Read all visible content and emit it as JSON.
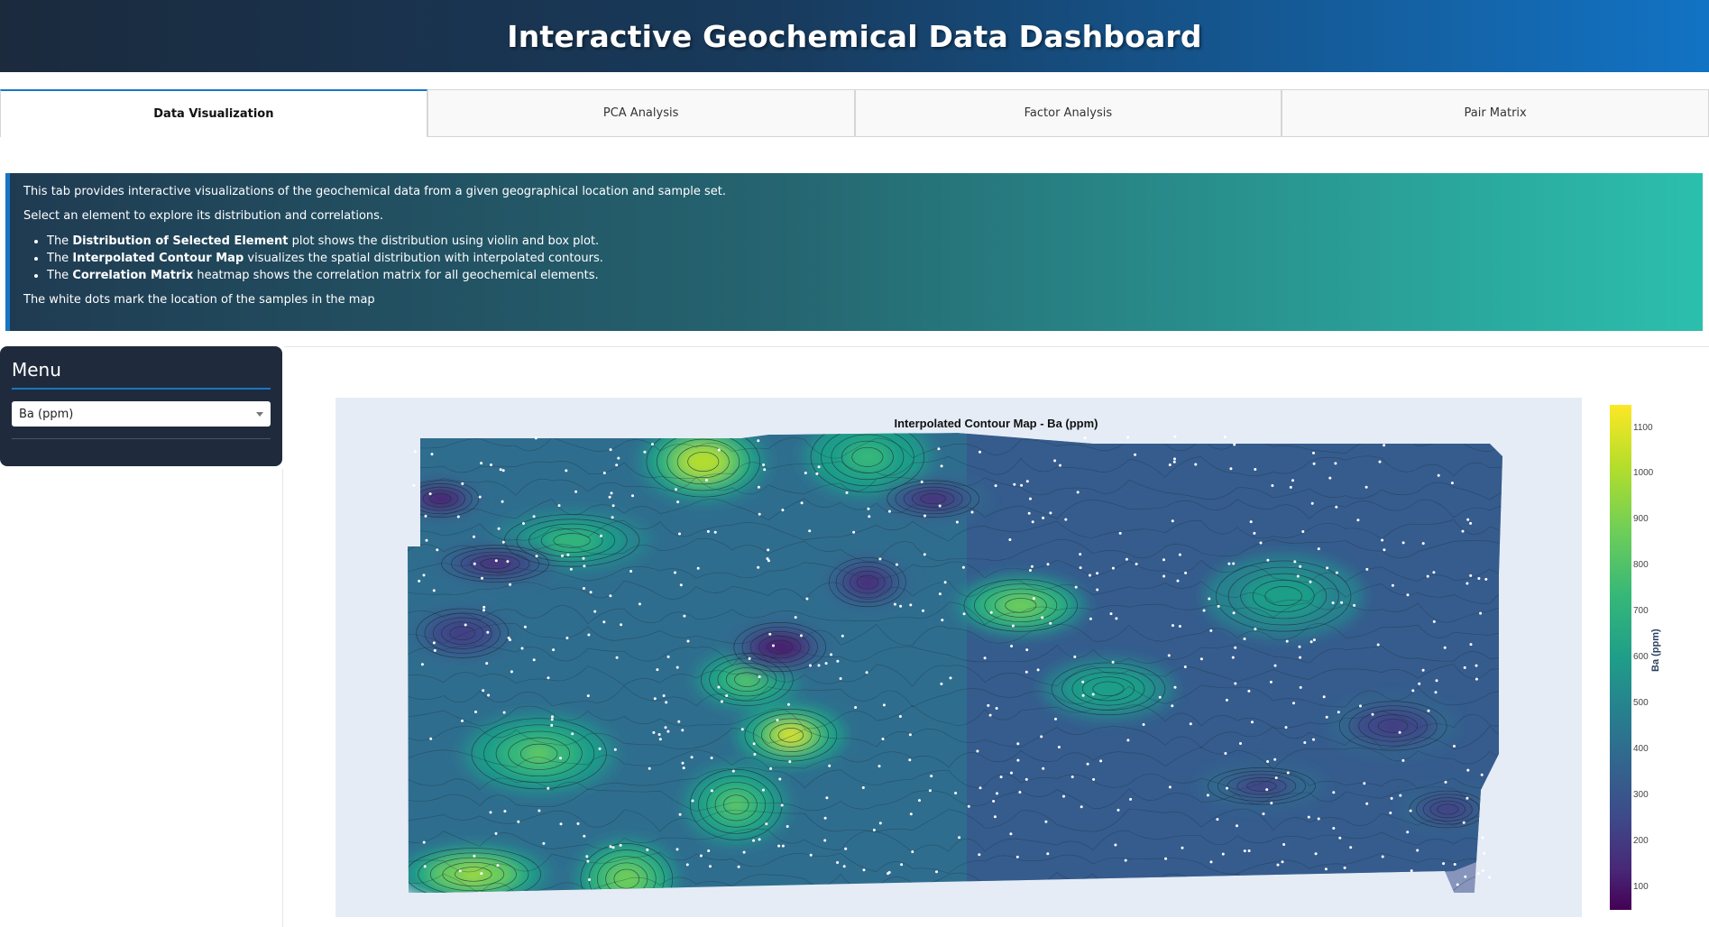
{
  "header": {
    "title": "Interactive Geochemical Data Dashboard"
  },
  "tabs": [
    {
      "label": "Data Visualization",
      "active": true
    },
    {
      "label": "PCA Analysis",
      "active": false
    },
    {
      "label": "Factor Analysis",
      "active": false
    },
    {
      "label": "Pair Matrix",
      "active": false
    }
  ],
  "info": {
    "line1": "This tab provides interactive visualizations of the geochemical data from a given geographical location and sample set.",
    "line2": "Select an element to explore its distribution and correlations.",
    "bullets": [
      {
        "pre": "The ",
        "bold": "Distribution of Selected Element",
        "post": " plot shows the distribution using violin and box plot."
      },
      {
        "pre": "The ",
        "bold": "Interpolated Contour Map",
        "post": " visualizes the spatial distribution with interpolated contours."
      },
      {
        "pre": "The ",
        "bold": "Correlation Matrix",
        "post": " heatmap shows the correlation matrix for all geochemical elements."
      }
    ],
    "line3": "The white dots mark the location of the samples in the map"
  },
  "menu": {
    "title": "Menu",
    "selected_element": "Ba (ppm)"
  },
  "chart_data": {
    "type": "heatmap",
    "title": "Interpolated Contour Map - Ba (ppm)",
    "colorbar_title": "Ba (ppm)",
    "colorbar_range": [
      50,
      1150
    ],
    "colorbar_ticks": [
      100,
      200,
      300,
      400,
      500,
      600,
      700,
      800,
      900,
      1000,
      1100
    ],
    "colorscale": "viridis",
    "hotspots": [
      {
        "x": 0.35,
        "y": 0.66,
        "value": 1100
      },
      {
        "x": 0.27,
        "y": 0.07,
        "value": 1080
      },
      {
        "x": 0.06,
        "y": 0.96,
        "value": 1050
      },
      {
        "x": 0.2,
        "y": 0.97,
        "value": 960
      },
      {
        "x": 0.56,
        "y": 0.38,
        "value": 950
      },
      {
        "x": 0.12,
        "y": 0.7,
        "value": 900
      },
      {
        "x": 0.31,
        "y": 0.54,
        "value": 860
      },
      {
        "x": 0.42,
        "y": 0.06,
        "value": 820
      },
      {
        "x": 0.15,
        "y": 0.24,
        "value": 780
      },
      {
        "x": 0.3,
        "y": 0.81,
        "value": 860
      },
      {
        "x": 0.64,
        "y": 0.56,
        "value": 720
      },
      {
        "x": 0.8,
        "y": 0.36,
        "value": 650
      }
    ],
    "lows": [
      {
        "x": 0.03,
        "y": 0.15,
        "value": 80
      },
      {
        "x": 0.34,
        "y": 0.47,
        "value": 90
      },
      {
        "x": 0.08,
        "y": 0.29,
        "value": 150
      },
      {
        "x": 0.42,
        "y": 0.33,
        "value": 160
      },
      {
        "x": 0.48,
        "y": 0.15,
        "value": 170
      },
      {
        "x": 0.9,
        "y": 0.64,
        "value": 200
      },
      {
        "x": 0.95,
        "y": 0.82,
        "value": 190
      },
      {
        "x": 0.05,
        "y": 0.44,
        "value": 200
      },
      {
        "x": 0.78,
        "y": 0.77,
        "value": 230
      }
    ]
  }
}
